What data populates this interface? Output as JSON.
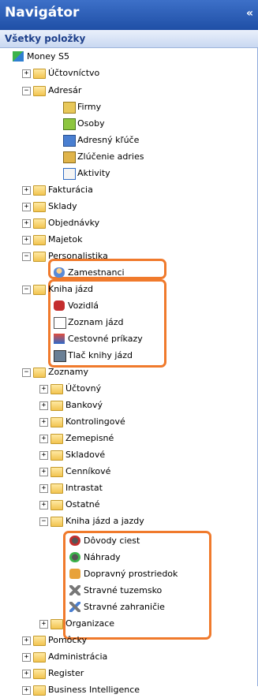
{
  "header": {
    "title": "Navigátor",
    "collapse": "«"
  },
  "subheader": {
    "label": "Všetky položky"
  },
  "tree": {
    "root": "Money S5",
    "uctovnictvo": "Účtovníctvo",
    "adresar": "Adresár",
    "firmy": "Firmy",
    "osoby": "Osoby",
    "adresne_kluce": "Adresný kľúče",
    "zlucenie": "Zlúčenie adries",
    "aktivity": "Aktivity",
    "fakturacia": "Fakturácia",
    "sklady": "Sklady",
    "objednavky": "Objednávky",
    "majetok": "Majetok",
    "personalistika": "Personalistika",
    "zamestnanci": "Zamestnanci",
    "kniha_jazd": "Kniha jázd",
    "vozidla": "Vozidlá",
    "zoznam_jazd": "Zoznam jázd",
    "cestovne": "Cestovné príkazy",
    "tlac": "Tlač knihy jázd",
    "zoznamy": "Zoznamy",
    "uctovny": "Účtovný",
    "bankovy": "Bankový",
    "kontrolingove": "Kontrolingové",
    "zemepisne": "Zemepisné",
    "skladove": "Skladové",
    "cennikove": "Cenníkové",
    "intrastat": "Intrastat",
    "ostatne": "Ostatné",
    "kniha_jazdy": "Kniha jázd a jazdy",
    "dovody": "Dôvody ciest",
    "nahrady": "Náhrady",
    "dopravny": "Dopravný prostriedok",
    "stravne_tuz": "Stravné tuzemsko",
    "stravne_zah": "Stravné zahraničie",
    "organizace": "Organizace",
    "pomocky": "Pomôcky",
    "administracia": "Administrácia",
    "register": "Register",
    "bi": "Business Intelligence"
  },
  "colors": {
    "highlight": "#f07a2c",
    "header": "#2a5cb3"
  }
}
